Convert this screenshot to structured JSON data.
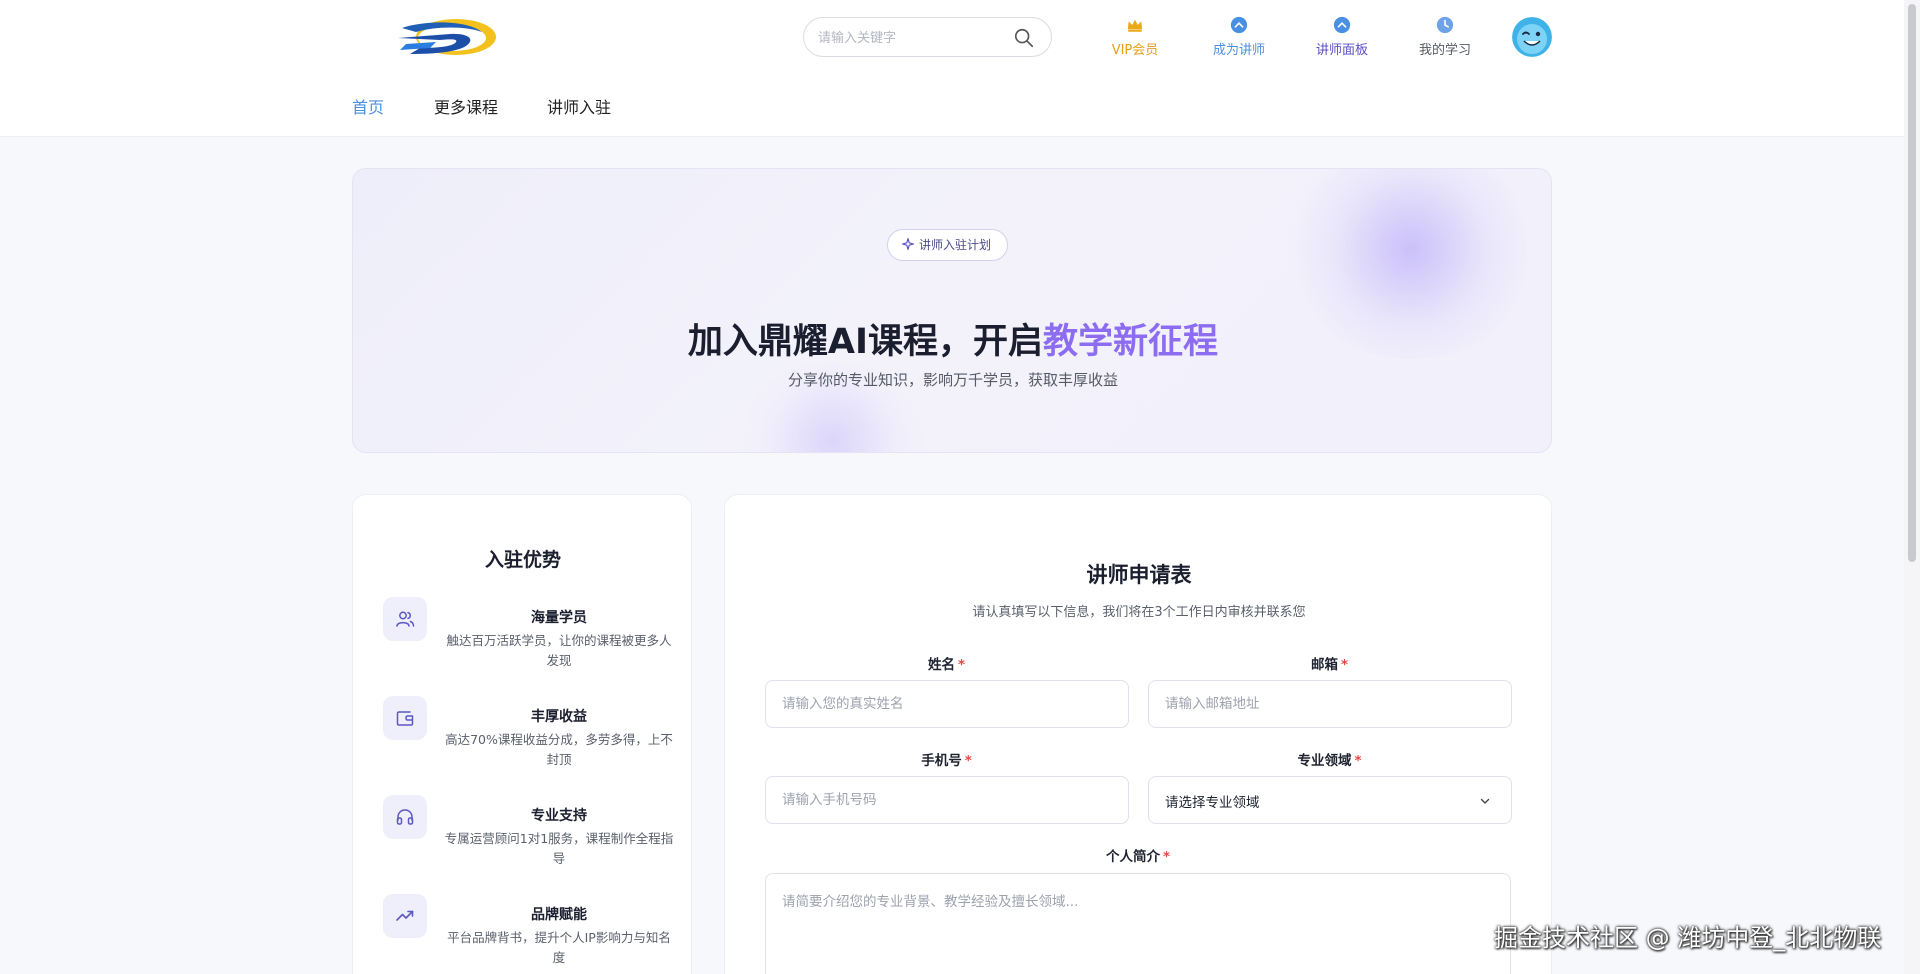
{
  "header": {
    "logo_icon": "brand-logo-swoosh",
    "search": {
      "placeholder": "请输入关键字",
      "icon": "search-icon"
    },
    "nav_icons": [
      {
        "label": "VIP会员",
        "icon": "crown-icon",
        "color": "#e2a11a"
      },
      {
        "label": "成为讲师",
        "icon": "chevron-up-circle-icon",
        "color": "#4a90e2"
      },
      {
        "label": "讲师面板",
        "icon": "chevron-up-circle-icon",
        "color": "#5b4fc4"
      },
      {
        "label": "我的学习",
        "icon": "clock-icon",
        "color": "#555a66"
      }
    ],
    "tabs": [
      {
        "label": "首页",
        "active": true
      },
      {
        "label": "更多课程",
        "active": false
      },
      {
        "label": "讲师入驻",
        "active": false
      }
    ]
  },
  "hero": {
    "badge": "讲师入驻计划",
    "title_main": "加入鼎耀AI课程，开启",
    "title_accent": "教学新征程",
    "subtitle": "分享你的专业知识，影响万千学员，获取丰厚收益"
  },
  "advantages": {
    "title": "入驻优势",
    "items": [
      {
        "icon": "users-icon",
        "title": "海量学员",
        "desc": "触达百万活跃学员，让你的课程被更多人发现"
      },
      {
        "icon": "wallet-icon",
        "title": "丰厚收益",
        "desc": "高达70%课程收益分成，多劳多得，上不封顶"
      },
      {
        "icon": "headphones-icon",
        "title": "专业支持",
        "desc": "专属运营顾问1对1服务，课程制作全程指导"
      },
      {
        "icon": "trending-up-icon",
        "title": "品牌赋能",
        "desc": "平台品牌背书，提升个人IP影响力与知名度"
      }
    ]
  },
  "form": {
    "title": "讲师申请表",
    "subtitle": "请认真填写以下信息，我们将在3个工作日内审核并联系您",
    "name": {
      "label": "姓名",
      "placeholder": "请输入您的真实姓名"
    },
    "email": {
      "label": "邮箱",
      "placeholder": "请输入邮箱地址"
    },
    "phone": {
      "label": "手机号",
      "placeholder": "请输入手机号码"
    },
    "field": {
      "label": "专业领域",
      "value": "请选择专业领域"
    },
    "bio": {
      "label": "个人简介",
      "placeholder": "请简要介绍您的专业背景、教学经验及擅长领域..."
    },
    "required_mark": "*"
  },
  "watermark": "掘金技术社区 @ 潍坊中登_北北物联"
}
